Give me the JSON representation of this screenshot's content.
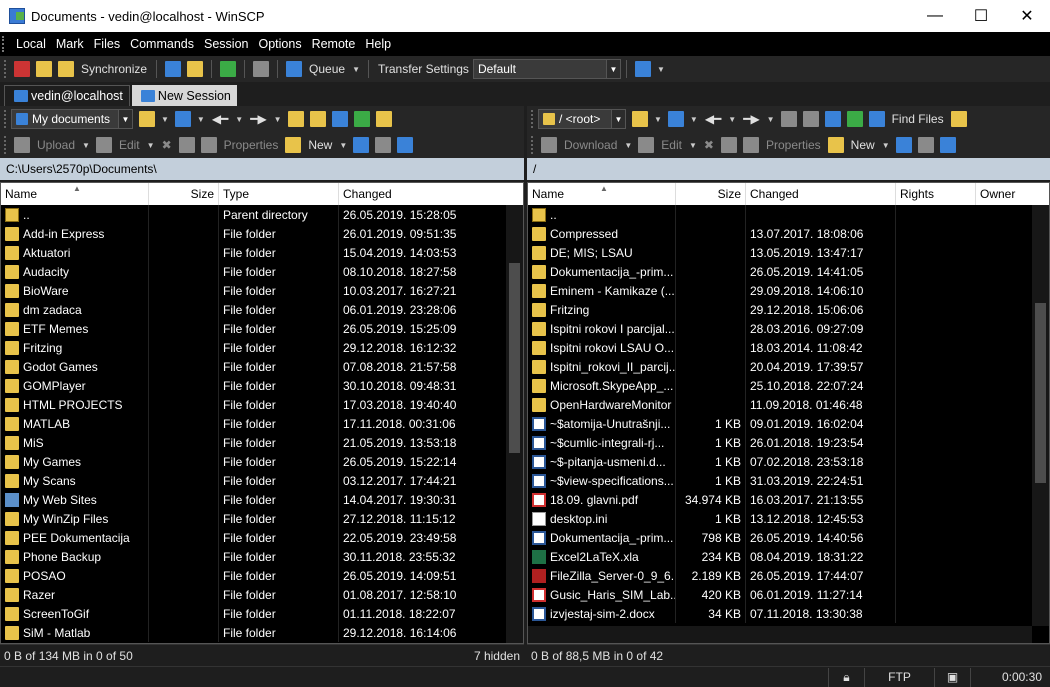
{
  "window": {
    "title": "Documents - vedin@localhost - WinSCP",
    "minimize": "—",
    "maximize": "☐",
    "close": "✕"
  },
  "menu": [
    "Local",
    "Mark",
    "Files",
    "Commands",
    "Session",
    "Options",
    "Remote",
    "Help"
  ],
  "toolbar": {
    "synchronize": "Synchronize",
    "queue": "Queue",
    "transfer_label": "Transfer Settings",
    "transfer_value": "Default"
  },
  "tabs": {
    "session": "vedin@localhost",
    "new_session": "New Session"
  },
  "left": {
    "location": "My documents",
    "upload": "Upload",
    "edit": "Edit",
    "properties": "Properties",
    "new": "New",
    "path": "C:\\Users\\2570p\\Documents\\",
    "columns": {
      "name": "Name",
      "size": "Size",
      "type": "Type",
      "changed": "Changed"
    },
    "rows": [
      {
        "name": "..",
        "size": "",
        "type": "Parent directory",
        "changed": "26.05.2019.  15:28:05",
        "icon": "up"
      },
      {
        "name": "Add-in Express",
        "size": "",
        "type": "File folder",
        "changed": "26.01.2019.  09:51:35",
        "icon": "folder"
      },
      {
        "name": "Aktuatori",
        "size": "",
        "type": "File folder",
        "changed": "15.04.2019.  14:03:53",
        "icon": "folder"
      },
      {
        "name": "Audacity",
        "size": "",
        "type": "File folder",
        "changed": "08.10.2018.  18:27:58",
        "icon": "folder"
      },
      {
        "name": "BioWare",
        "size": "",
        "type": "File folder",
        "changed": "10.03.2017.  16:27:21",
        "icon": "folder"
      },
      {
        "name": "dm zadaca",
        "size": "",
        "type": "File folder",
        "changed": "06.01.2019.  23:28:06",
        "icon": "folder"
      },
      {
        "name": "ETF Memes",
        "size": "",
        "type": "File folder",
        "changed": "26.05.2019.  15:25:09",
        "icon": "folder"
      },
      {
        "name": "Fritzing",
        "size": "",
        "type": "File folder",
        "changed": "29.12.2018.  16:12:32",
        "icon": "folder"
      },
      {
        "name": "Godot Games",
        "size": "",
        "type": "File folder",
        "changed": "07.08.2018.  21:57:58",
        "icon": "folder"
      },
      {
        "name": "GOMPlayer",
        "size": "",
        "type": "File folder",
        "changed": "30.10.2018.  09:48:31",
        "icon": "folder"
      },
      {
        "name": "HTML PROJECTS",
        "size": "",
        "type": "File folder",
        "changed": "17.03.2018.  19:40:40",
        "icon": "folder"
      },
      {
        "name": "MATLAB",
        "size": "",
        "type": "File folder",
        "changed": "17.11.2018.  00:31:06",
        "icon": "folder"
      },
      {
        "name": "MiS",
        "size": "",
        "type": "File folder",
        "changed": "21.05.2019.  13:53:18",
        "icon": "folder"
      },
      {
        "name": "My Games",
        "size": "",
        "type": "File folder",
        "changed": "26.05.2019.  15:22:14",
        "icon": "folder"
      },
      {
        "name": "My Scans",
        "size": "",
        "type": "File folder",
        "changed": "03.12.2017.  17:44:21",
        "icon": "folder"
      },
      {
        "name": "My Web Sites",
        "size": "",
        "type": "File folder",
        "changed": "14.04.2017.  19:30:31",
        "icon": "web"
      },
      {
        "name": "My WinZip Files",
        "size": "",
        "type": "File folder",
        "changed": "27.12.2018.  11:15:12",
        "icon": "folder"
      },
      {
        "name": "PEE Dokumentacija",
        "size": "",
        "type": "File folder",
        "changed": "22.05.2019.  23:49:58",
        "icon": "folder"
      },
      {
        "name": "Phone Backup",
        "size": "",
        "type": "File folder",
        "changed": "30.11.2018.  23:55:32",
        "icon": "folder"
      },
      {
        "name": "POSAO",
        "size": "",
        "type": "File folder",
        "changed": "26.05.2019.  14:09:51",
        "icon": "folder"
      },
      {
        "name": "Razer",
        "size": "",
        "type": "File folder",
        "changed": "01.08.2017.  12:58:10",
        "icon": "folder"
      },
      {
        "name": "ScreenToGif",
        "size": "",
        "type": "File folder",
        "changed": "01.11.2018.  18:22:07",
        "icon": "folder"
      },
      {
        "name": "SiM - Matlab",
        "size": "",
        "type": "File folder",
        "changed": "29.12.2018.  16:14:06",
        "icon": "folder"
      }
    ],
    "status_left": "0 B of 134 MB in 0 of 50",
    "status_right": "7 hidden"
  },
  "right": {
    "location": "/ <root>",
    "download": "Download",
    "edit": "Edit",
    "properties": "Properties",
    "new": "New",
    "find": "Find Files",
    "path": "/",
    "columns": {
      "name": "Name",
      "size": "Size",
      "changed": "Changed",
      "rights": "Rights",
      "owner": "Owner"
    },
    "rows": [
      {
        "name": "..",
        "size": "",
        "changed": "",
        "icon": "up"
      },
      {
        "name": "Compressed",
        "size": "",
        "changed": "13.07.2017. 18:08:06",
        "icon": "folder"
      },
      {
        "name": "DE; MIS; LSAU",
        "size": "",
        "changed": "13.05.2019. 13:47:17",
        "icon": "folder"
      },
      {
        "name": "Dokumentacija_-prim...",
        "size": "",
        "changed": "26.05.2019. 14:41:05",
        "icon": "folder"
      },
      {
        "name": "Eminem - Kamikaze (...",
        "size": "",
        "changed": "29.09.2018. 14:06:10",
        "icon": "folder"
      },
      {
        "name": "Fritzing",
        "size": "",
        "changed": "29.12.2018. 15:06:06",
        "icon": "folder"
      },
      {
        "name": "Ispitni rokovi I parcijal...",
        "size": "",
        "changed": "28.03.2016. 09:27:09",
        "icon": "folder"
      },
      {
        "name": "Ispitni rokovi LSAU O...",
        "size": "",
        "changed": "18.03.2014. 11:08:42",
        "icon": "folder"
      },
      {
        "name": "Ispitni_rokovi_II_parcij...",
        "size": "",
        "changed": "20.04.2019. 17:39:57",
        "icon": "folder"
      },
      {
        "name": "Microsoft.SkypeApp_...",
        "size": "",
        "changed": "25.10.2018. 22:07:24",
        "icon": "folder"
      },
      {
        "name": "OpenHardwareMonitor",
        "size": "",
        "changed": "11.09.2018. 01:46:48",
        "icon": "folder"
      },
      {
        "name": "~$atomija-Unutrašnji...",
        "size": "1 KB",
        "changed": "09.01.2019. 16:02:04",
        "icon": "doc"
      },
      {
        "name": "~$cumlic-integrali-rj...",
        "size": "1 KB",
        "changed": "26.01.2018. 19:23:54",
        "icon": "doc"
      },
      {
        "name": "~$-pitanja-usmeni.d...",
        "size": "1 KB",
        "changed": "07.02.2018. 23:53:18",
        "icon": "doc"
      },
      {
        "name": "~$view-specifications...",
        "size": "1 KB",
        "changed": "31.03.2019. 22:24:51",
        "icon": "doc"
      },
      {
        "name": "18.09. glavni.pdf",
        "size": "34.974 KB",
        "changed": "16.03.2017. 21:13:55",
        "icon": "pdf"
      },
      {
        "name": "desktop.ini",
        "size": "1 KB",
        "changed": "13.12.2018. 12:45:53",
        "icon": "ini"
      },
      {
        "name": "Dokumentacija_-prim...",
        "size": "798 KB",
        "changed": "26.05.2019. 14:40:56",
        "icon": "doc"
      },
      {
        "name": "Excel2LaTeX.xla",
        "size": "234 KB",
        "changed": "08.04.2019. 18:31:22",
        "icon": "xla"
      },
      {
        "name": "FileZilla_Server-0_9_6...",
        "size": "2.189 KB",
        "changed": "26.05.2019. 17:44:07",
        "icon": "exe"
      },
      {
        "name": "Gusic_Haris_SIM_Lab...",
        "size": "420 KB",
        "changed": "06.01.2019. 11:27:14",
        "icon": "pdf"
      },
      {
        "name": "izvjestaj-sim-2.docx",
        "size": "34 KB",
        "changed": "07.11.2018. 13:30:38",
        "icon": "doc"
      }
    ],
    "status_left": "0 B of 88,5 MB in 0 of 42"
  },
  "bottom": {
    "protocol": "FTP",
    "timer": "0:00:30"
  }
}
